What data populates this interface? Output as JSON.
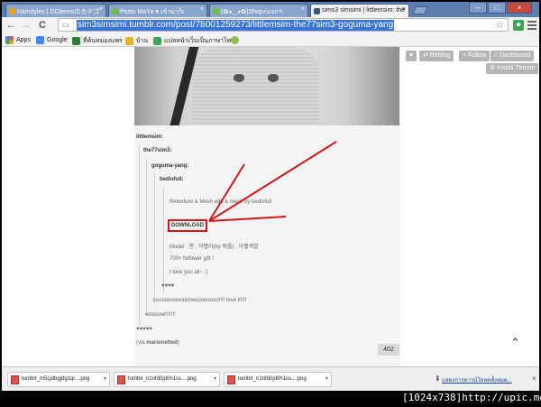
{
  "tabs": [
    {
      "title": "Hairstyles | DCitemsのカテゴ",
      "icon_color": "#f0a020"
    },
    {
      "title": "Posts MaYa ♥ เข้ามาก็เ",
      "icon_color": "#6fbf3f"
    },
    {
      "title": "(✿◕‿◕✿)Shop+แจกฯ",
      "icon_color": "#6fbf3f"
    },
    {
      "title": "sims3 simsimi | littlemsim: the",
      "icon_color": "#39577a"
    }
  ],
  "toolbar": {
    "back": "←",
    "forward": "→",
    "reload": "C",
    "url": "sim3simsimi.tumblr.com/post/78001259273/littlemsim-the77sim3-goguma-yang",
    "star": "☆"
  },
  "bookmarks": [
    {
      "label": "Apps",
      "icon_color": "#d9534f"
    },
    {
      "label": "Google",
      "icon_color": "#4285f4"
    },
    {
      "label": "ที่ค้นหมองแพร",
      "icon_color": "#2e7d32"
    },
    {
      "label": "บ้าน",
      "icon_color": "#e6b422"
    },
    {
      "label": "แปลหน้าเว็บเป็นภาษาไท...",
      "icon_color": "#3aa655"
    },
    {
      "label": "",
      "icon_color": "#8bc34a"
    }
  ],
  "tumblr_controls": {
    "heart": "♥",
    "reblog": "⇄ Reblog",
    "follow": "+ Follow",
    "dashboard": "⌂ Dashboard",
    "install_theme": "⚙ Install Theme"
  },
  "post": {
    "chain": [
      "littlemsim:",
      "the77sim3:",
      "goguma-yang:",
      "bedisfull:"
    ],
    "retexture": "Retexture & Mesh edit & mesh by bedisfull",
    "download": "DOWNLOAD",
    "model": "Model : 핸 , 야쨀리(by 애플) , 아쨀계열",
    "gift": "700+ follower gift !",
    "love": "I love you all~ :)",
    "hearts": "♥♥♥♥",
    "cocoo": "cocooooooooooooooooooo!!!! love it!!!!",
    "wooow": "woooow!!!!!!!",
    "stars": "♥♥♥♥♥",
    "via_prefix": "(via ",
    "via_name": "marionetted",
    "via_suffix": ")",
    "notes": "402"
  },
  "downloads": [
    {
      "name": "tumblr_m5cjdbgjdg1qi....png"
    },
    {
      "name": "tumblr_n1nfd0jd0h1ss....png"
    },
    {
      "name": "tumblr_n1nfd0jd0h1ss....png"
    }
  ],
  "downloads_show_all": "แสดงการดาวน์โหลดทั้งหมด...",
  "watermark": "[1024x738]http://upic.me/",
  "accent_red": "#d01a1a"
}
